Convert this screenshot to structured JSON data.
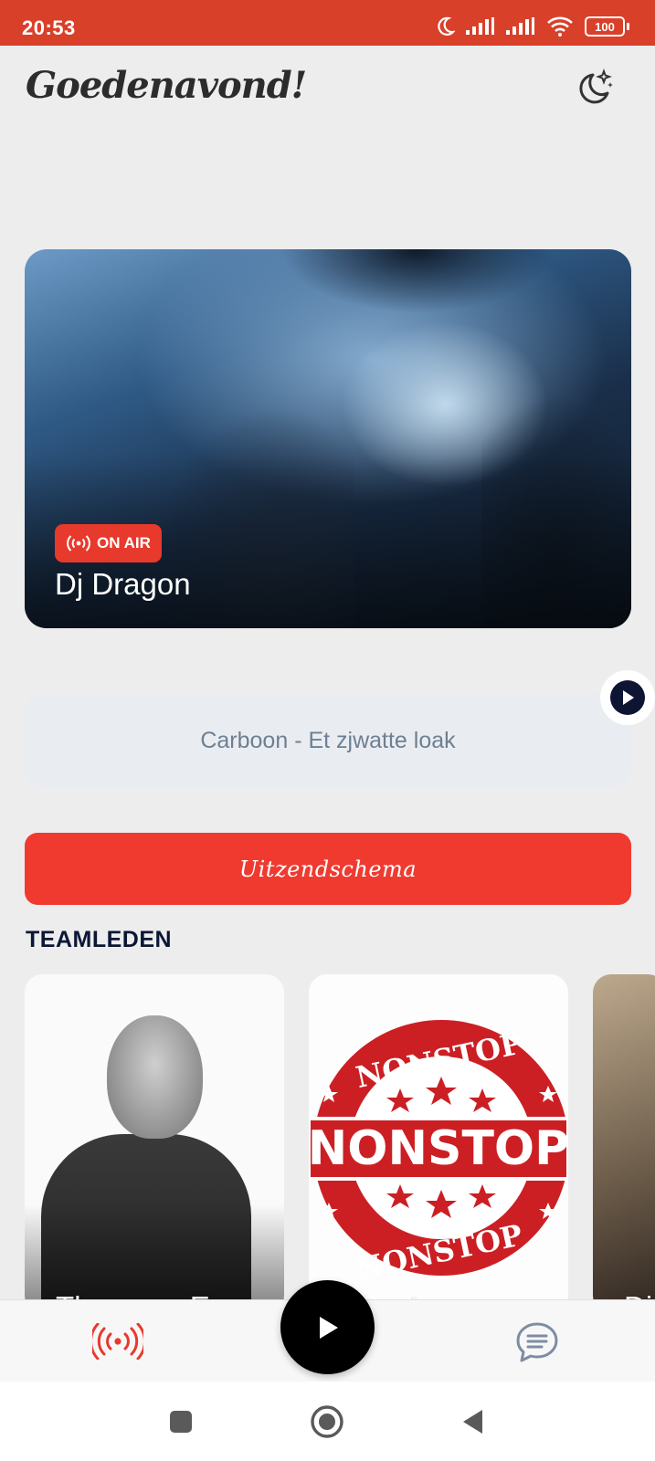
{
  "status_bar": {
    "time": "20:53",
    "battery": "100",
    "icons": [
      "moon-icon",
      "signal-icon",
      "signal-icon",
      "wifi-icon",
      "battery-icon"
    ]
  },
  "header": {
    "greeting": "Goedenavond!",
    "theme_toggle_icon": "moon-stars-icon"
  },
  "hero": {
    "badge": "ON AIR",
    "badge_icon": "broadcast-icon",
    "dj_name": "Dj Dragon"
  },
  "now_playing": {
    "track": "Carboon - Et zjwatte loak",
    "play_icon": "play-icon"
  },
  "schedule_button": "Uitzendschema",
  "team": {
    "title": "TEAMLEDEN",
    "members": [
      {
        "name": "Theo van Erp"
      },
      {
        "name": "Nonstop"
      },
      {
        "name": "Di"
      }
    ],
    "nonstop_badge_text": "NONSTOP"
  },
  "bottom_nav": {
    "items": [
      "broadcast-icon",
      "play-icon",
      "chat-icon"
    ]
  },
  "system_nav": {
    "items": [
      "recents-icon",
      "home-icon",
      "back-icon"
    ]
  },
  "colors": {
    "status_bar": "#d8402a",
    "accent_red": "#f03a30",
    "navy": "#0c1735",
    "now_playing_bg": "#e9edf2"
  }
}
